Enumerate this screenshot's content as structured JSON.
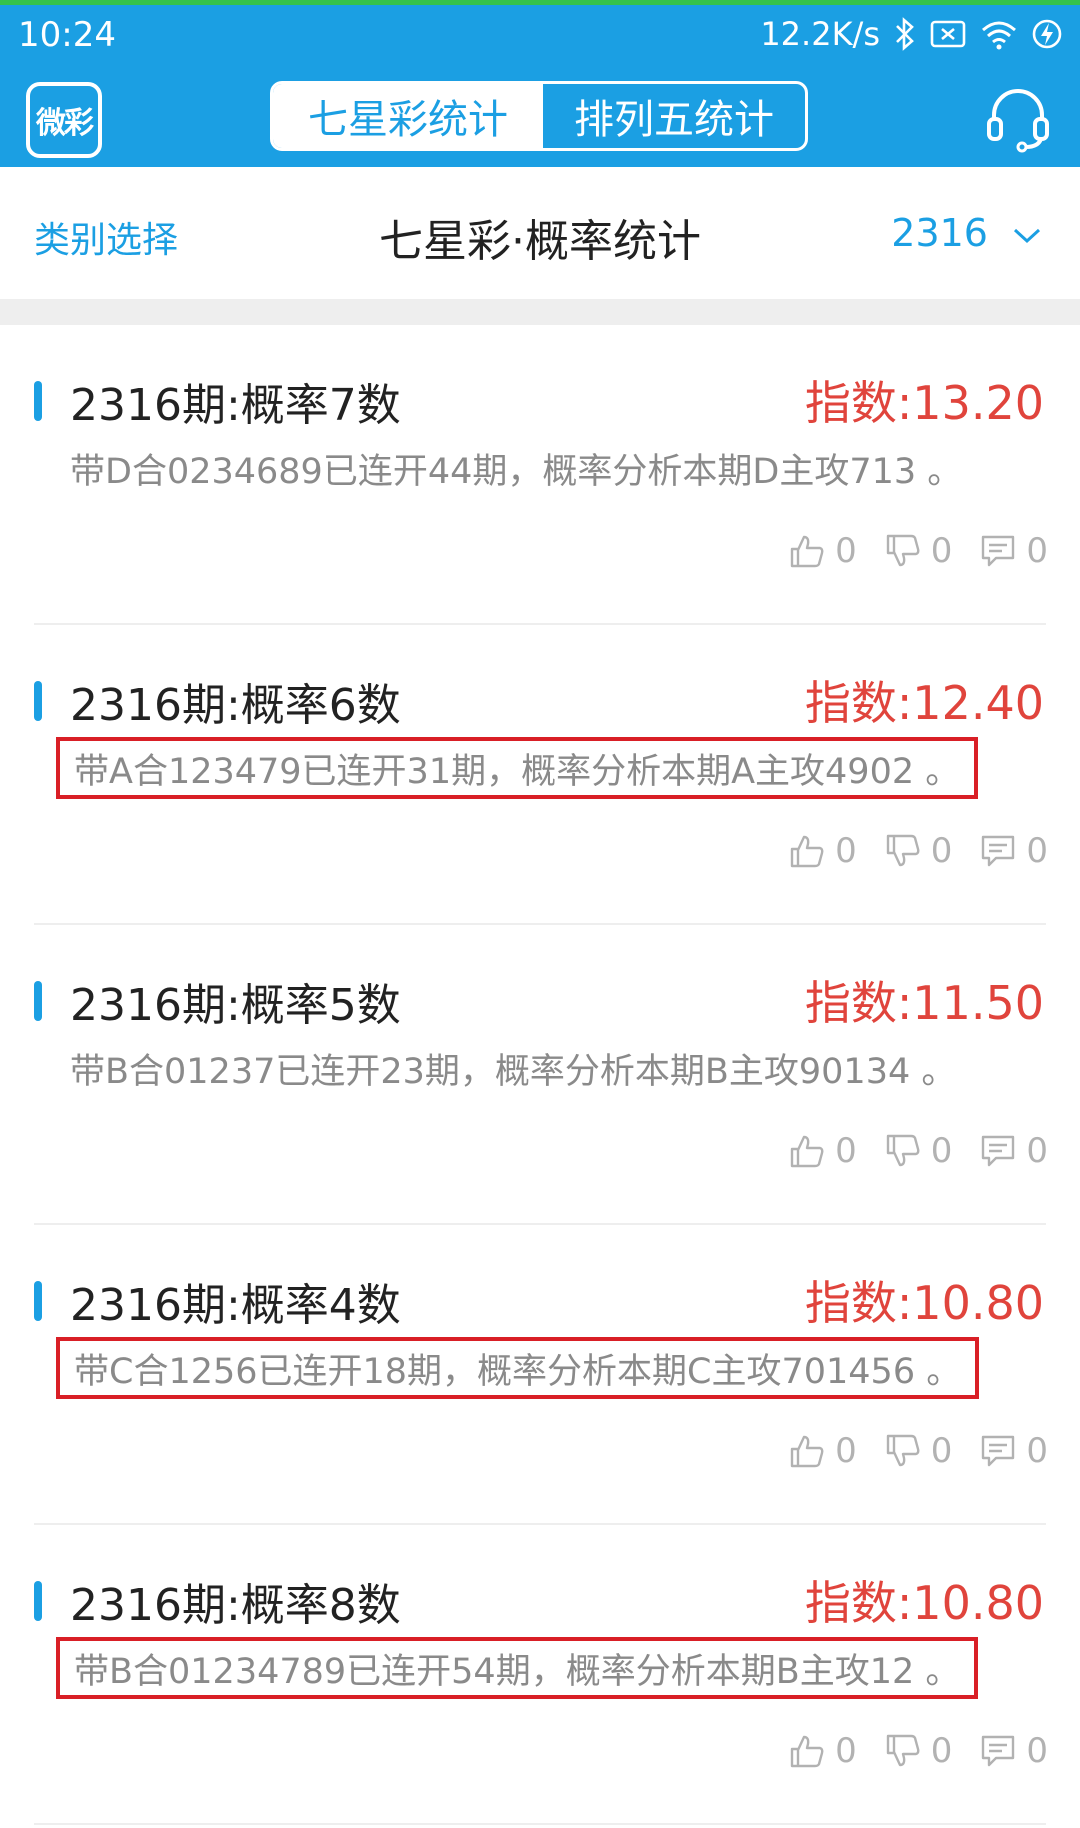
{
  "status_bar": {
    "time": "10:24",
    "net_speed": "12.2K/s",
    "icons": [
      "bluetooth-icon",
      "sim-disabled-icon",
      "wifi-icon",
      "battery-charging-icon"
    ]
  },
  "app_bar": {
    "logo_text": "微彩",
    "tabs": [
      {
        "label": "七星彩统计",
        "active": true
      },
      {
        "label": "排列五统计",
        "active": false
      }
    ],
    "right_icon": "headset-icon"
  },
  "sub_header": {
    "category_label": "类别选择",
    "title": "七星彩·概率统计",
    "issue": "2316"
  },
  "colors": {
    "brand": "#1b9fe3",
    "index_red": "#e0443c",
    "highlight": "#d91f26",
    "desc_gray": "#8a8a8a",
    "action_gray": "#b2b2b2"
  },
  "items": [
    {
      "title": "2316期:概率7数",
      "index": "指数:13.20",
      "desc": "带D合0234689已连开44期，概率分析本期D主攻713 。",
      "highlighted": false,
      "likes": "0",
      "dislikes": "0",
      "comments": "0"
    },
    {
      "title": "2316期:概率6数",
      "index": "指数:12.40",
      "desc": "带A合123479已连开31期，概率分析本期A主攻4902 。",
      "highlighted": true,
      "likes": "0",
      "dislikes": "0",
      "comments": "0"
    },
    {
      "title": "2316期:概率5数",
      "index": "指数:11.50",
      "desc": "带B合01237已连开23期，概率分析本期B主攻90134 。",
      "highlighted": false,
      "likes": "0",
      "dislikes": "0",
      "comments": "0"
    },
    {
      "title": "2316期:概率4数",
      "index": "指数:10.80",
      "desc": "带C合1256已连开18期，概率分析本期C主攻701456 。",
      "highlighted": true,
      "likes": "0",
      "dislikes": "0",
      "comments": "0"
    },
    {
      "title": "2316期:概率8数",
      "index": "指数:10.80",
      "desc": "带B合01234789已连开54期，概率分析本期B主攻12 。",
      "highlighted": true,
      "likes": "0",
      "dislikes": "0",
      "comments": "0"
    }
  ]
}
